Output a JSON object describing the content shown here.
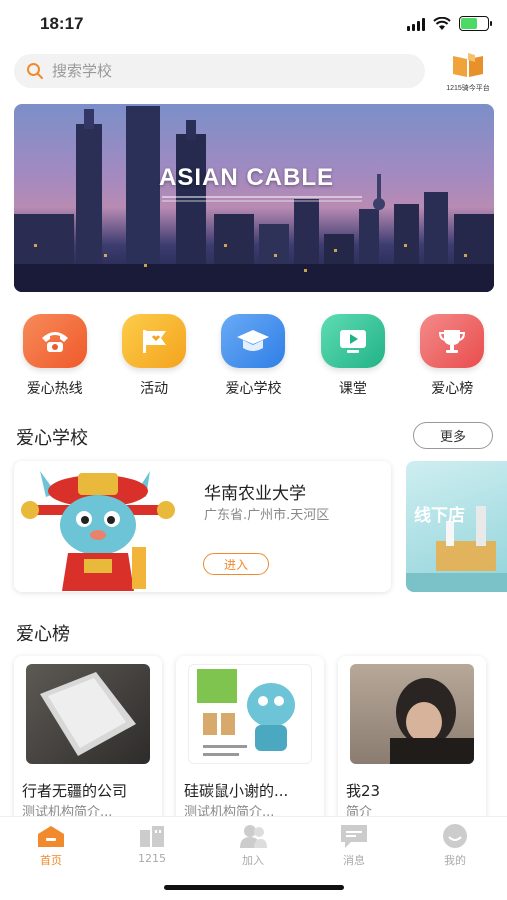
{
  "status": {
    "time": "18:17"
  },
  "search": {
    "placeholder": "搜索学校"
  },
  "platform": {
    "label": "1215骑今平台"
  },
  "banner": {
    "title": "ASIAN CABLE"
  },
  "quick_nav": [
    {
      "label": "爱心热线",
      "icon": "phone-icon",
      "color": "#f26a3c"
    },
    {
      "label": "活动",
      "icon": "flag-icon",
      "color": "#f7b32b"
    },
    {
      "label": "爱心学校",
      "icon": "graduation-cap-icon",
      "color": "#3d8ff0"
    },
    {
      "label": "课堂",
      "icon": "video-play-icon",
      "color": "#2fc49a"
    },
    {
      "label": "爱心榜",
      "icon": "trophy-icon",
      "color": "#ee5a5a"
    }
  ],
  "school_section": {
    "title": "爱心学校",
    "more_label": "更多",
    "card": {
      "name": "华南农业大学",
      "location": "广东省.广州市.天河区",
      "enter_label": "进入"
    },
    "card2": {
      "text": "线下店"
    }
  },
  "rank_section": {
    "title": "爱心榜",
    "items": [
      {
        "name": "行者无疆的公司",
        "desc": "测试机构简介..."
      },
      {
        "name": "硅碳鼠小谢的...",
        "desc": "测试机构简介..."
      },
      {
        "name": "我23",
        "desc": "简介"
      }
    ]
  },
  "tab_bar": [
    {
      "label": "首页",
      "icon": "home-icon",
      "active": true
    },
    {
      "label": "1215",
      "icon": "building-icon",
      "active": false
    },
    {
      "label": "加入",
      "icon": "users-icon",
      "active": false
    },
    {
      "label": "消息",
      "icon": "message-icon",
      "active": false
    },
    {
      "label": "我的",
      "icon": "profile-icon",
      "active": false
    }
  ],
  "colors": {
    "accent": "#f08a2c",
    "tab_inactive": "#aaaaaa"
  }
}
